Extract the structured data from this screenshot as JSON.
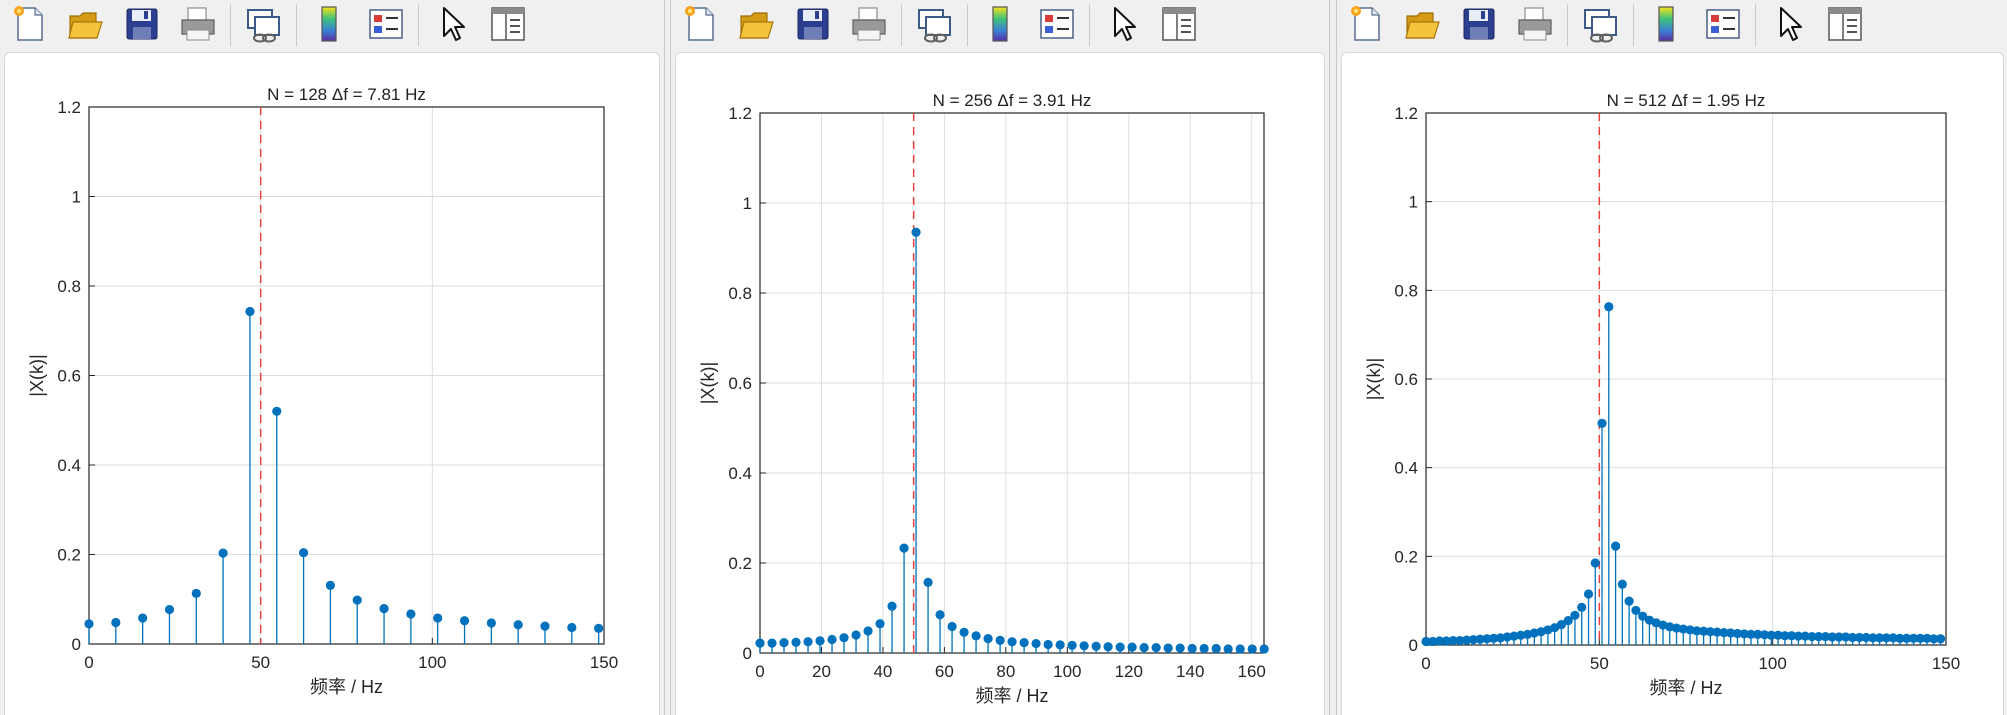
{
  "toolbar": {
    "buttons": [
      {
        "name": "new-figure-icon"
      },
      {
        "name": "open-file-icon"
      },
      {
        "name": "save-icon"
      },
      {
        "name": "print-icon"
      },
      {
        "name": "link-plot-icon"
      },
      {
        "name": "colorbar-icon"
      },
      {
        "name": "legend-icon"
      },
      {
        "name": "edit-plot-cursor-icon"
      },
      {
        "name": "property-inspector-icon"
      }
    ]
  },
  "colors": {
    "stem": "#0072bd",
    "reference_line": "#e8413a"
  },
  "chart_data": [
    {
      "type": "stem",
      "title": "N = 128   Δf = 7.81 Hz",
      "xlabel": "频率 / Hz",
      "ylabel": "|X(k)|",
      "xlim": [
        0,
        150
      ],
      "ylim": [
        0,
        1.2
      ],
      "xticks": [
        0,
        50,
        100,
        150
      ],
      "yticks": [
        0,
        0.2,
        0.4,
        0.6,
        0.8,
        1,
        1.2
      ],
      "grid": true,
      "reference_x": 50,
      "x": [
        0,
        7.81,
        15.63,
        23.44,
        31.25,
        39.06,
        46.88,
        54.69,
        62.5,
        70.31,
        78.13,
        85.94,
        93.75,
        101.56,
        109.38,
        117.19,
        125,
        132.81,
        140.63,
        148.44
      ],
      "values": [
        0.045,
        0.048,
        0.058,
        0.077,
        0.113,
        0.203,
        0.743,
        0.52,
        0.204,
        0.131,
        0.098,
        0.079,
        0.067,
        0.058,
        0.052,
        0.047,
        0.043,
        0.04,
        0.037,
        0.035
      ]
    },
    {
      "type": "stem",
      "title": "N = 256   Δf = 3.91 Hz",
      "xlabel": "频率 / Hz",
      "ylabel": "|X(k)|",
      "xlim": [
        0,
        164
      ],
      "ylim": [
        0,
        1.2
      ],
      "xticks": [
        0,
        20,
        40,
        60,
        80,
        100,
        120,
        140,
        160
      ],
      "yticks": [
        0,
        0.2,
        0.4,
        0.6,
        0.8,
        1,
        1.2
      ],
      "grid": true,
      "reference_x": 50,
      "x": [
        0,
        3.91,
        7.81,
        11.72,
        15.63,
        19.53,
        23.44,
        27.34,
        31.25,
        35.16,
        39.06,
        42.97,
        46.88,
        50.78,
        54.69,
        58.59,
        62.5,
        66.41,
        70.31,
        74.22,
        78.13,
        82.03,
        85.94,
        89.84,
        93.75,
        97.66,
        101.56,
        105.47,
        109.38,
        113.28,
        117.19,
        121.09,
        125,
        128.91,
        132.81,
        136.72,
        140.63,
        144.53,
        148.44,
        152.34,
        156.25,
        160.16,
        164.06
      ],
      "values": [
        0.022,
        0.022,
        0.023,
        0.024,
        0.025,
        0.027,
        0.03,
        0.034,
        0.04,
        0.049,
        0.065,
        0.104,
        0.233,
        0.935,
        0.157,
        0.085,
        0.059,
        0.046,
        0.038,
        0.032,
        0.028,
        0.025,
        0.023,
        0.021,
        0.019,
        0.018,
        0.017,
        0.016,
        0.015,
        0.014,
        0.013,
        0.013,
        0.012,
        0.012,
        0.011,
        0.011,
        0.01,
        0.01,
        0.01,
        0.009,
        0.009,
        0.009,
        0.009
      ]
    },
    {
      "type": "stem",
      "title": "N = 512   Δf = 1.95 Hz",
      "xlabel": "频率 / Hz",
      "ylabel": "|X(k)|",
      "xlim": [
        0,
        150
      ],
      "ylim": [
        0,
        1.2
      ],
      "xticks": [
        0,
        50,
        100,
        150
      ],
      "yticks": [
        0,
        0.2,
        0.4,
        0.6,
        0.8,
        1,
        1.2
      ],
      "grid": true,
      "reference_x": 50,
      "x": [
        0,
        1.95,
        3.91,
        5.86,
        7.81,
        9.77,
        11.72,
        13.67,
        15.63,
        17.58,
        19.53,
        21.48,
        23.44,
        25.39,
        27.34,
        29.3,
        31.25,
        33.2,
        35.16,
        37.11,
        39.06,
        41.02,
        42.97,
        44.92,
        46.88,
        48.83,
        50.78,
        52.73,
        54.69,
        56.64,
        58.59,
        60.55,
        62.5,
        64.45,
        66.41,
        68.36,
        70.31,
        72.27,
        74.22,
        76.17,
        78.13,
        80.08,
        82.03,
        83.98,
        85.94,
        87.89,
        89.84,
        91.8,
        93.75,
        95.7,
        97.66,
        99.61,
        101.56,
        103.52,
        105.47,
        107.42,
        109.38,
        111.33,
        113.28,
        115.23,
        117.19,
        119.14,
        121.09,
        123.05,
        125,
        126.95,
        128.91,
        130.86,
        132.81,
        134.77,
        136.72,
        138.67,
        140.63,
        142.58,
        144.53,
        146.48,
        148.44
      ],
      "values": [
        0.008,
        0.008,
        0.009,
        0.009,
        0.01,
        0.01,
        0.011,
        0.012,
        0.013,
        0.014,
        0.015,
        0.016,
        0.018,
        0.02,
        0.022,
        0.024,
        0.027,
        0.03,
        0.034,
        0.039,
        0.046,
        0.055,
        0.067,
        0.085,
        0.115,
        0.185,
        0.5,
        0.763,
        0.223,
        0.137,
        0.099,
        0.078,
        0.065,
        0.056,
        0.05,
        0.045,
        0.041,
        0.038,
        0.036,
        0.034,
        0.032,
        0.031,
        0.03,
        0.029,
        0.028,
        0.027,
        0.026,
        0.025,
        0.024,
        0.024,
        0.023,
        0.022,
        0.022,
        0.021,
        0.021,
        0.02,
        0.02,
        0.019,
        0.019,
        0.019,
        0.018,
        0.018,
        0.018,
        0.017,
        0.017,
        0.017,
        0.016,
        0.016,
        0.016,
        0.016,
        0.015,
        0.015,
        0.015,
        0.015,
        0.015,
        0.014,
        0.014
      ]
    }
  ]
}
